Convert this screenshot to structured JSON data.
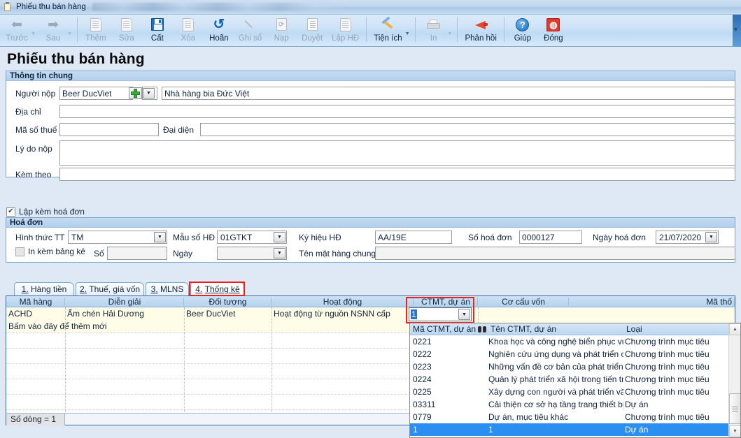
{
  "window": {
    "title": "Phiếu thu bán hàng",
    "icon": "document-window-icon"
  },
  "toolbar": {
    "buttons": [
      {
        "label": "Trước",
        "icon": "arrow-left-icon",
        "enabled": false,
        "caret": true
      },
      {
        "label": "Sau",
        "icon": "arrow-right-icon",
        "enabled": false,
        "caret": true
      },
      {
        "label": "Thêm",
        "icon": "add-document-icon",
        "enabled": false,
        "caret": false
      },
      {
        "label": "Sửa",
        "icon": "edit-document-icon",
        "enabled": false,
        "caret": false
      },
      {
        "label": "Cất",
        "icon": "save-floppy-icon",
        "enabled": true,
        "caret": false
      },
      {
        "label": "Xóa",
        "icon": "delete-document-icon",
        "enabled": false,
        "caret": false
      },
      {
        "label": "Hoãn",
        "icon": "undo-arrow-icon",
        "enabled": true,
        "caret": false
      },
      {
        "label": "Ghi sổ",
        "icon": "pencil-icon",
        "enabled": false,
        "caret": false
      },
      {
        "label": "Nạp",
        "icon": "refresh-document-icon",
        "enabled": false,
        "caret": false
      },
      {
        "label": "Duyệt",
        "icon": "approve-list-icon",
        "enabled": false,
        "caret": false
      },
      {
        "label": "Lập HĐ",
        "icon": "create-invoice-icon",
        "enabled": false,
        "caret": false
      },
      {
        "label": "Tiện ích",
        "icon": "tools-icon",
        "enabled": true,
        "caret": true
      },
      {
        "label": "In",
        "icon": "printer-icon",
        "enabled": false,
        "caret": true
      },
      {
        "label": "Phản hồi",
        "icon": "megaphone-icon",
        "enabled": true,
        "caret": false
      },
      {
        "label": "Giúp",
        "icon": "help-circle-icon",
        "enabled": true,
        "caret": false
      },
      {
        "label": "Đóng",
        "icon": "close-power-icon",
        "enabled": true,
        "caret": false
      }
    ],
    "overflow_glyph": "▼"
  },
  "page": {
    "title": "Phiếu thu bán hàng"
  },
  "general_info": {
    "group_title": "Thông tin chung",
    "payer_label": "Người nộp",
    "payer_code": "Beer DucViet",
    "payer_name": "Nhà hàng bia Đức Việt",
    "address_label": "Địa chỉ",
    "address_value": "",
    "tax_code_label": "Mã số thuế",
    "tax_code_value": "",
    "representative_label": "Đại diện",
    "representative_value": "",
    "reason_label": "Lý do nộp",
    "reason_value": "",
    "attachment_label": "Kèm theo",
    "attachment_value": ""
  },
  "invoice_checkbox": {
    "label": "Lập kèm hoá đơn",
    "checked": true,
    "mark": "✔"
  },
  "invoice": {
    "group_title": "Hoá đơn",
    "payment_method_label": "Hình thức TT",
    "payment_method_value": "TM",
    "form_no_label": "Mẫu số HĐ",
    "form_no_value": "01GTKT",
    "symbol_label": "Ký hiệu HĐ",
    "symbol_value": "AA/19E",
    "invoice_no_label": "Số hoá đơn",
    "invoice_no_value": "0000127",
    "invoice_date_label": "Ngày hoá đơn",
    "invoice_date_value": "21/07/2020",
    "print_list_label": "In kèm bảng kê",
    "print_list_checked": false,
    "list_no_label": "Số",
    "list_no_value": "",
    "list_date_label": "Ngày",
    "list_date_value": "",
    "common_goods_label": "Tên mặt hàng chung",
    "common_goods_value": ""
  },
  "tabs": [
    {
      "num": "1.",
      "label": "Hàng tiền",
      "selected": false,
      "highlighted": false
    },
    {
      "num": "2.",
      "label": "Thuế, giá vốn",
      "selected": false,
      "highlighted": false
    },
    {
      "num": "3.",
      "label": "MLNS",
      "selected": false,
      "highlighted": false
    },
    {
      "num": "4.",
      "label": "Thống kê",
      "selected": true,
      "highlighted": true
    }
  ],
  "grid": {
    "columns": [
      "Mã hàng",
      "Diễn giải",
      "Đối tượng",
      "Hoạt động",
      "CTMT, dự án",
      "Cơ cấu vốn",
      "Mã thố"
    ],
    "rows": [
      {
        "ma_hang": "ACHD",
        "dien_giai": "Ấm chén Hải Dương",
        "doi_tuong": "Beer DucViet",
        "hoat_dong": "Hoạt động từ nguồn NSNN cấp",
        "ctmt": "1",
        "co_cau_von": "",
        "ma_tho": ""
      }
    ],
    "new_row_hint": "Bấm vào đây để thêm mới",
    "status_text": "Số dòng = 1",
    "editing_cell_value": "1",
    "highlighted_column": "CTMT, dự án"
  },
  "dropdown": {
    "columns": [
      "Mã CTMT, dự án",
      "Tên CTMT, dự án",
      "Loại"
    ],
    "search_icon": "binoculars-icon",
    "items": [
      {
        "code": "0221",
        "name": "Khoa học và công nghệ biển phục vụ..",
        "type": "Chương trình mục tiêu",
        "selected": false
      },
      {
        "code": "0222",
        "name": "Nghiên cứu ứng dụng và phát triển cô..",
        "type": "Chương trình mục tiêu",
        "selected": false
      },
      {
        "code": "0223",
        "name": "Những vấn đề cơ bản của phát triển k..",
        "type": "Chương trình mục tiêu",
        "selected": false
      },
      {
        "code": "0224",
        "name": "Quản lý phát triển xã hội trong tiến trì..",
        "type": "Chương trình mục tiêu",
        "selected": false
      },
      {
        "code": "0225",
        "name": "Xây dựng con người và phát triển văn..",
        "type": "Chương trình mục tiêu",
        "selected": false
      },
      {
        "code": "03311",
        "name": "Cải thiện cơ sở hạ tầng trang thiết bị t..",
        "type": "Dự án",
        "selected": false
      },
      {
        "code": "0779",
        "name": "Dự án, mục tiêu khác",
        "type": "Chương trình mục tiêu",
        "selected": false
      },
      {
        "code": "1",
        "name": "1",
        "type": "Dự án",
        "selected": true
      }
    ],
    "scroll_up_glyph": "▲",
    "scroll_down_glyph": "▼"
  },
  "colors": {
    "accent_blue": "#2b6ba8",
    "highlight_red": "#f02020",
    "selection_blue": "#2a8ff0",
    "row_yellow": "#fffde8",
    "window_bg": "#dfe9f6"
  }
}
